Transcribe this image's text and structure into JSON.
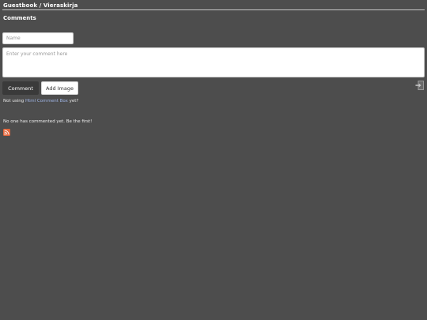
{
  "header": {
    "title": "Guestbook / Vieraskirja"
  },
  "comments_section": {
    "heading": "Comments",
    "name_input": {
      "placeholder": "Name",
      "value": ""
    },
    "comment_input": {
      "placeholder": "Enter your comment here",
      "value": ""
    },
    "comment_button_label": "Comment",
    "add_image_button_label": "Add Image",
    "login_icon": "login-icon",
    "promo": {
      "prefix": "Not using",
      "link_text": "Html Comment Box",
      "suffix": "yet?"
    },
    "empty_message": "No one has commented yet. Be the first!",
    "rss_icon": "rss-icon"
  },
  "colors": {
    "background": "#4d4d4d",
    "link": "#9fb5e6",
    "rss": "#e2653a",
    "comment_button": "#3a3a3a"
  }
}
